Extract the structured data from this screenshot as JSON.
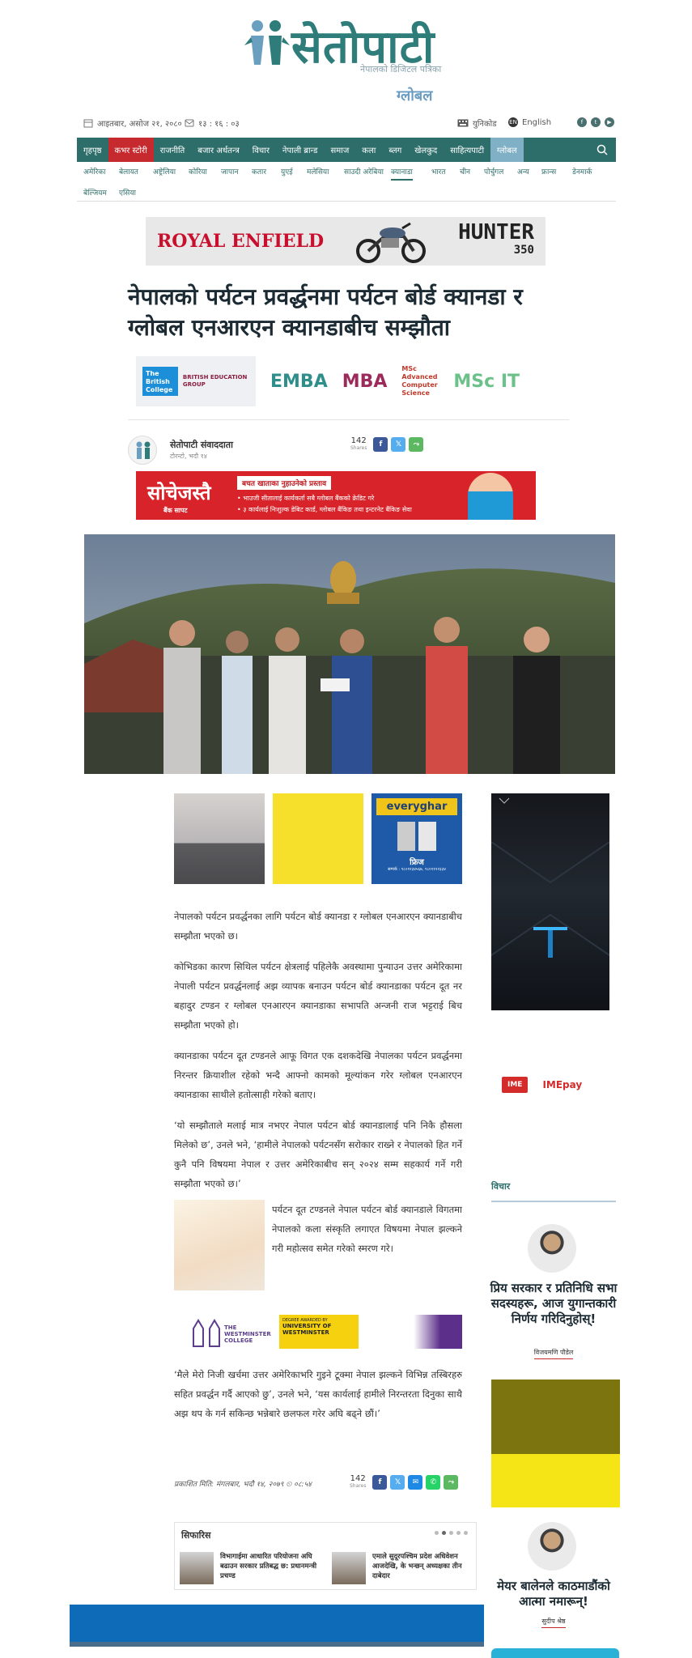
{
  "site": {
    "logo_text": "सेतोपाटी",
    "tagline": "नेपालको डिजिटल पत्रिका",
    "edition": "ग्लोबल"
  },
  "topbar": {
    "date": "आइतबार, असोज २१, २०८०",
    "time": "१३ : १६ : ०३",
    "unicode_label": "युनिकोड",
    "english_label": "English",
    "lang_badge": "EN"
  },
  "nav": {
    "items": [
      {
        "label": "गृहपृष्ठ"
      },
      {
        "label": "कभर स्टोरी"
      },
      {
        "label": "राजनीति"
      },
      {
        "label": "बजार अर्थतन्त्र"
      },
      {
        "label": "विचार"
      },
      {
        "label": "नेपाली ब्रान्ड"
      },
      {
        "label": "समाज"
      },
      {
        "label": "कला"
      },
      {
        "label": "ब्लग"
      },
      {
        "label": "खेलकुद"
      },
      {
        "label": "साहित्यपाटी"
      },
      {
        "label": "ग्लोबल"
      }
    ]
  },
  "subnav": {
    "items": [
      {
        "label": "अमेरिका"
      },
      {
        "label": "बेलायत"
      },
      {
        "label": "अष्ट्रेलिया"
      },
      {
        "label": "कोरिया"
      },
      {
        "label": "जापान"
      },
      {
        "label": "कतार"
      },
      {
        "label": "युएई"
      },
      {
        "label": "मलेसिया"
      },
      {
        "label": "साउदी अरेबिया"
      },
      {
        "label": "क्यानाडा"
      },
      {
        "label": "भारत"
      },
      {
        "label": "चीन"
      },
      {
        "label": "पोर्चुगल"
      },
      {
        "label": "अन्य"
      },
      {
        "label": "फ्रान्स"
      },
      {
        "label": "डेनमार्क"
      },
      {
        "label": "बेल्जियम"
      },
      {
        "label": "एसिया"
      }
    ]
  },
  "ads": {
    "royal_enfield": {
      "brand": "ROYAL ENFIELD",
      "model": "HUNTER",
      "model_num": "350"
    },
    "education": {
      "college": "The British College",
      "group": "BRITISH EDUCATION GROUP",
      "emba": "EMBA",
      "mba": "MBA",
      "mscit": "MSc IT",
      "cs": "MSc Advanced Computer Science"
    },
    "red": {
      "brand": "सोचेजस्तै",
      "sub": "बैंक सापट",
      "head": "बचत खाताका नुहाउनेको प्रस्ताव",
      "line1": "• भाउजी सीतालाई कार्यकर्ता सबै ग्लोबल बैंकको क्रेडिट गरे",
      "line2": "• ३ कार्यलाई निःशुल्क डेबिट कार्ड, ग्लोबल बैंकिङ तथा इन्टरनेट बैंकिङ सेवा"
    },
    "everyghar": {
      "brand": "everyghar",
      "title": "फ्रिज",
      "phone": "सम्पर्क : ९८०१२३४५६७, ९८०११२२३३४"
    },
    "westminster": {
      "college": "THE WESTMINSTER COLLEGE",
      "award": "DEGREE AWARDED BY",
      "uni": "UNIVERSITY OF WESTMINSTER"
    },
    "ime": {
      "label": "IME",
      "pay": "IMEpay"
    }
  },
  "article": {
    "title": "नेपालको पर्यटन प्रवर्द्धनमा पर्यटन बोर्ड क्यानडा र ग्लोबल एनआरएन क्यानडाबीच सम्झौता",
    "author": "सेतोपाटी संवाददाता",
    "place": "टोरन्टो, भदौ १४",
    "share_count": "142",
    "share_label": "Shares",
    "paragraphs": [
      "नेपालको पर्यटन प्रवर्द्धनका लागि पर्यटन बोर्ड क्यानडा र ग्लोबल एनआरएन क्यानडाबीच सम्झौता भएको छ।",
      "कोभिडका कारण सिथिल पर्यटन क्षेत्रलाई पहिलेकै अवस्थामा पुन्याउन उत्तर अमेरिकामा नेपाली पर्यटन प्रवर्द्धनलाई अझ व्यापक बनाउन पर्यटन बोर्ड क्यानडाका पर्यटन दूत नर बहादुर टण्डन र ग्लोबल एनआरएन क्यानडाका सभापति अन्जनी राज भट्टराई बिच सम्झौता भएको हो।",
      "क्यानडाका पर्यटन दूत टण्डनले आफू विगत एक दशकदेखि नेपालका पर्यटन प्रवर्द्धनमा निरन्तर क्रियाशील रहेको भन्दै आफ्नो कामको मूल्यांकन गरेर ग्लोबल एनआरएन क्यानडाका साथीले हतोत्साही गरेको बताए।",
      "‘यो सम्झौताले मलाई मात्र नभएर नेपाल पर्यटन बोर्ड क्यानडालाई पनि निकै हौसला मिलेको छ’, उनले भने, ‘हामीले नेपालको पर्यटनसँग सरोकार राख्ने र नेपालको हित गर्ने कुनै पनि विषयमा नेपाल र उत्तर अमेरिकाबीच सन् २०२४ सम्म सहकार्य गर्ने गरी सम्झौता भएको छ।’"
    ],
    "inline_paragraph": "पर्यटन दूत टण्डनले नेपाल पर्यटन बोर्ड क्यानडाले विगतमा नेपालको कला संस्कृति लगाएत विषयमा नेपाल झल्कने गरी महोत्सव समेत गरेको स्मरण गरे।",
    "last_paragraph": "‘मैले मेरो निजी खर्चमा उत्तर अमेरिकाभरि गुइने टूक्मा नेपाल झल्कने विभिन्न तस्बिरहरु सहित प्रवर्द्धन गर्दै आएको छु’, उनले भने, ‘यस कार्यलाई हामीले निरन्तरता दिनुका साथै अझ थप के गर्न सकिन्छ भन्नेबारे छलफल गरेर अघि बढ्ने छौं।’",
    "published": "प्रकाशित मिति: मंगलबार, भदौ १४, २०७९ ",
    "published_time": "०८:५४"
  },
  "recommend": {
    "title": "सिफारिस",
    "items": [
      {
        "text": "विभागाईमा आधारित परियोजना अघि बढाउन सरकार प्रतिबद्ध छ: प्रधानमन्त्री प्रचण्ड"
      },
      {
        "text": "एमाले सुदूरपश्चिम प्रदेश अधिवेशन आजदेखि, के भन्छन् अध्यक्षका तीन दाबेदार"
      }
    ]
  },
  "sidebar": {
    "opinion_heading": "विचार",
    "opinions": [
      {
        "title": "प्रिय सरकार र प्रतिनिधि सभा सदस्यहरू, आज युगान्तकारी निर्णय गरिदिनुहोस्!",
        "author": "विजयमणि पौडेल"
      },
      {
        "title": "मेयर बालेनले काठमाडौंको आत्मा नमारून्!",
        "author": "सुदीप श्रेष्ठ"
      }
    ]
  },
  "colors": {
    "brand_teal": "#2e6e6a",
    "cover_red": "#c62a2f",
    "global_blue": "#7fb0c6"
  }
}
